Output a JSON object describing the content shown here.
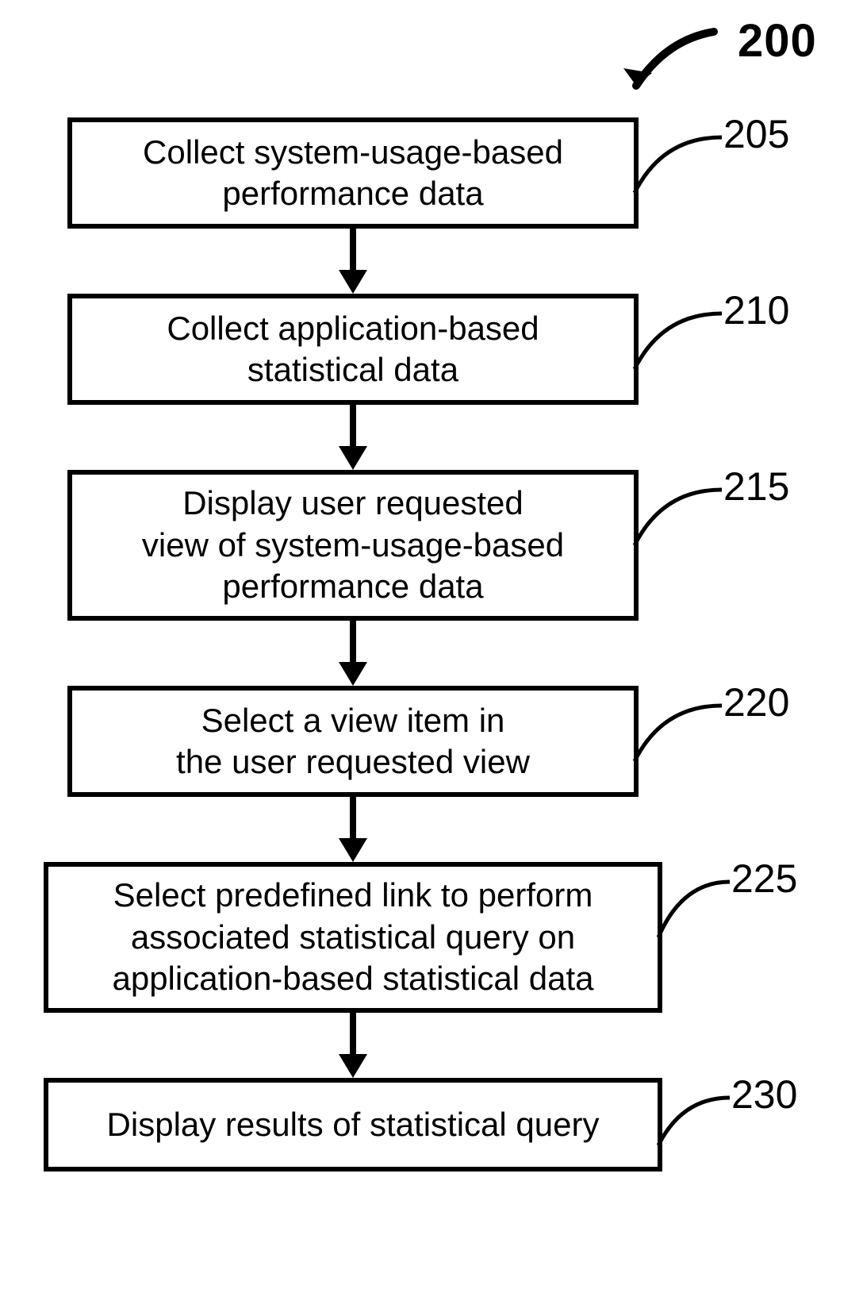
{
  "diagram": {
    "title_ref": "200",
    "steps": [
      {
        "id": "205",
        "text": "Collect system-usage-based\nperformance data"
      },
      {
        "id": "210",
        "text": "Collect application-based\nstatistical data"
      },
      {
        "id": "215",
        "text": "Display user requested\nview of system-usage-based\nperformance data"
      },
      {
        "id": "220",
        "text": "Select a view item in\nthe user requested view"
      },
      {
        "id": "225",
        "text": "Select predefined link to perform\nassociated statistical query on\napplication-based statistical data"
      },
      {
        "id": "230",
        "text": "Display results of statistical query"
      }
    ]
  }
}
